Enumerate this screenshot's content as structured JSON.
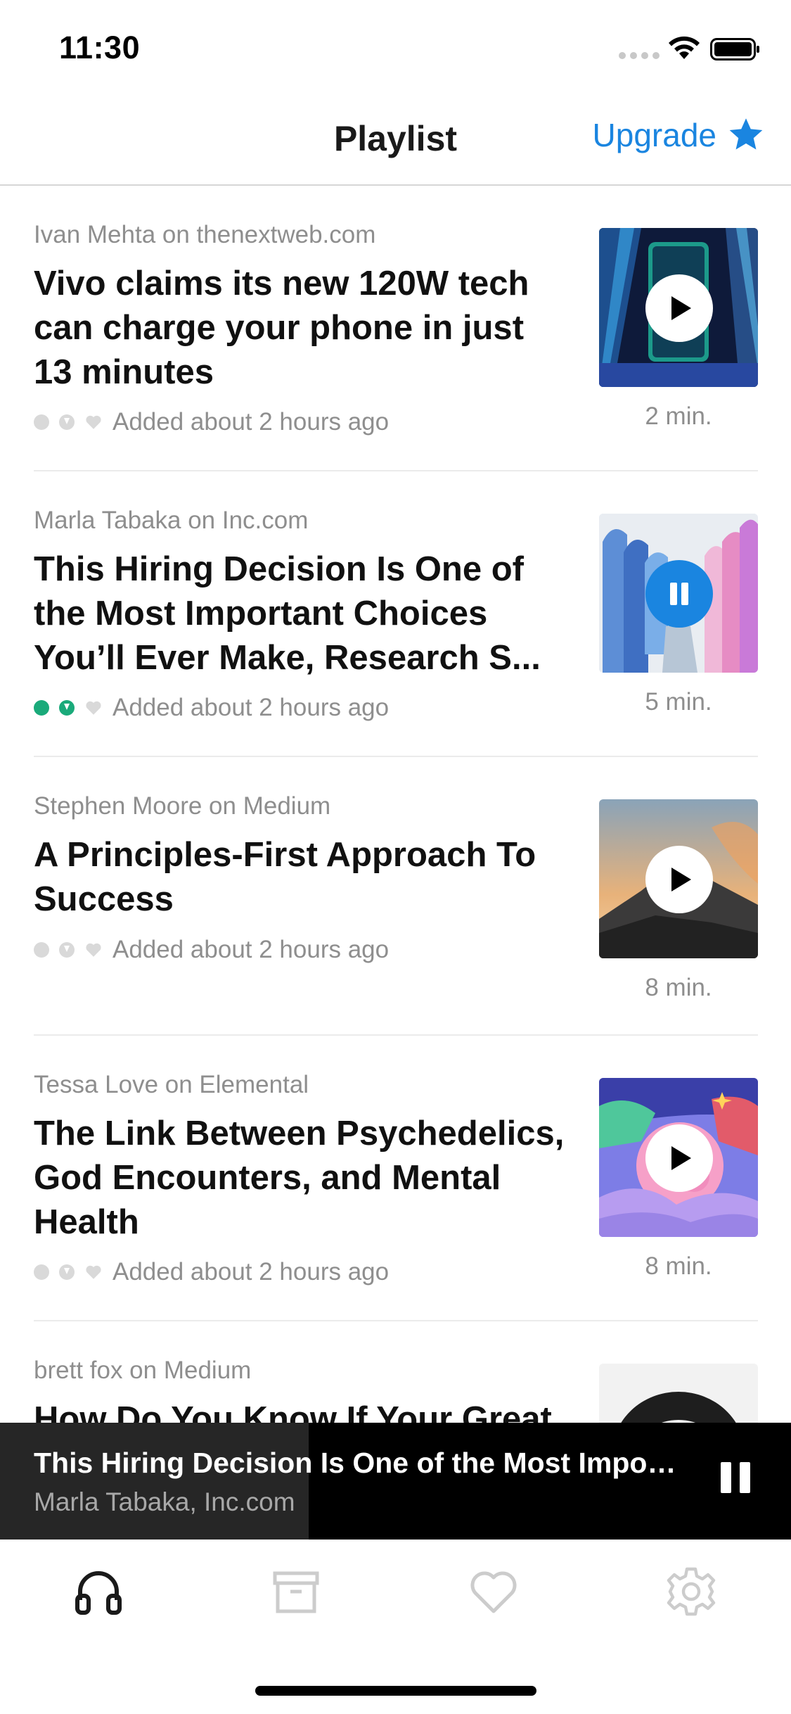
{
  "status": {
    "time": "11:30"
  },
  "header": {
    "title": "Playlist",
    "upgrade_label": "Upgrade"
  },
  "colors": {
    "accent": "#1a85e0",
    "download_green": "#1aaa7a",
    "muted": "#8e8e8e"
  },
  "articles": [
    {
      "source": "Ivan Mehta on thenextweb.com",
      "title": "Vivo claims its new 120W tech can charge your phone in just 13 minutes",
      "added": "Added about 2 hours ago",
      "duration": "2 min.",
      "state": "play",
      "downloaded": false,
      "thumbnail": "phone-charging-image"
    },
    {
      "source": "Marla Tabaka on Inc.com",
      "title": "This Hiring Decision Is One of the Most Important Choices You’ll Ever Make, Research S...",
      "added": "Added about 2 hours ago",
      "duration": "5 min.",
      "state": "pause",
      "downloaded": true,
      "thumbnail": "paper-figures-image"
    },
    {
      "source": "Stephen Moore on Medium",
      "title": "A Principles-First Approach To Success",
      "added": "Added about 2 hours ago",
      "duration": "8 min.",
      "state": "play",
      "downloaded": false,
      "thumbnail": "mountain-image"
    },
    {
      "source": "Tessa Love on Elemental",
      "title": "The Link Between Psychedelics, God Encounters, and Mental Health",
      "added": "Added about 2 hours ago",
      "duration": "8 min.",
      "state": "play",
      "downloaded": false,
      "thumbnail": "brain-illustration-image"
    },
    {
      "source": "brett fox on Medium",
      "title": "How Do You Know If Your Great",
      "thumbnail": "speaker-image"
    }
  ],
  "now_playing": {
    "title": "This Hiring Decision Is One of the Most Important Choices You’ll Ever Make",
    "subtitle": "Marla Tabaka, Inc.com",
    "progress": 0.39
  },
  "tabs": [
    {
      "icon": "headphones-icon",
      "active": true
    },
    {
      "icon": "archive-icon",
      "active": false
    },
    {
      "icon": "heart-icon",
      "active": false
    },
    {
      "icon": "gear-icon",
      "active": false
    }
  ]
}
